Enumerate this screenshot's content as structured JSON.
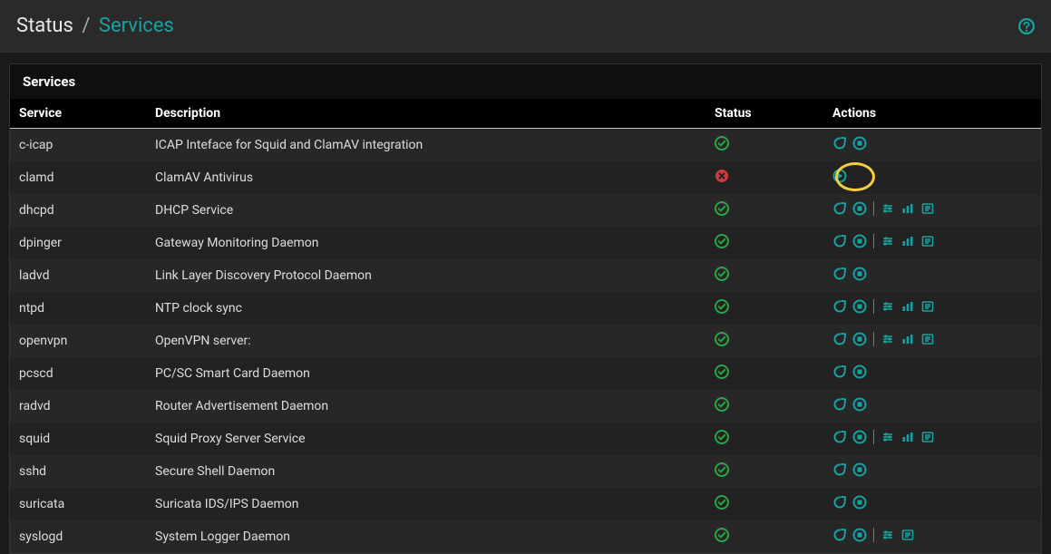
{
  "breadcrumb": {
    "root": "Status",
    "sep": "/",
    "leaf": "Services"
  },
  "panel_title": "Services",
  "columns": {
    "service": "Service",
    "description": "Description",
    "status": "Status",
    "actions": "Actions"
  },
  "icons": {
    "help": "help",
    "check": "check-circle",
    "times": "times-circle",
    "restart": "restart",
    "stop": "stop",
    "play": "play",
    "sliders": "sliders",
    "chart": "bar-chart",
    "log": "log"
  },
  "accent": "#17a2a0",
  "services": [
    {
      "name": "c-icap",
      "desc": "ICAP Inteface for Squid and ClamAV integration",
      "status": "ok",
      "actions": [
        "restart",
        "stop"
      ],
      "highlight": false
    },
    {
      "name": "clamd",
      "desc": "ClamAV Antivirus",
      "status": "bad",
      "actions": [
        "play"
      ],
      "highlight": true
    },
    {
      "name": "dhcpd",
      "desc": "DHCP Service",
      "status": "ok",
      "actions": [
        "restart",
        "stop",
        "|",
        "sliders",
        "chart",
        "log"
      ],
      "highlight": false
    },
    {
      "name": "dpinger",
      "desc": "Gateway Monitoring Daemon",
      "status": "ok",
      "actions": [
        "restart",
        "stop",
        "|",
        "sliders",
        "chart",
        "log"
      ],
      "highlight": false
    },
    {
      "name": "ladvd",
      "desc": "Link Layer Discovery Protocol Daemon",
      "status": "ok",
      "actions": [
        "restart",
        "stop"
      ],
      "highlight": false
    },
    {
      "name": "ntpd",
      "desc": "NTP clock sync",
      "status": "ok",
      "actions": [
        "restart",
        "stop",
        "|",
        "sliders",
        "chart",
        "log"
      ],
      "highlight": false
    },
    {
      "name": "openvpn",
      "desc": "OpenVPN server:",
      "status": "ok",
      "actions": [
        "restart",
        "stop",
        "|",
        "sliders",
        "chart",
        "log"
      ],
      "highlight": false
    },
    {
      "name": "pcscd",
      "desc": "PC/SC Smart Card Daemon",
      "status": "ok",
      "actions": [
        "restart",
        "stop"
      ],
      "highlight": false
    },
    {
      "name": "radvd",
      "desc": "Router Advertisement Daemon",
      "status": "ok",
      "actions": [
        "restart",
        "stop"
      ],
      "highlight": false
    },
    {
      "name": "squid",
      "desc": "Squid Proxy Server Service",
      "status": "ok",
      "actions": [
        "restart",
        "stop",
        "|",
        "sliders",
        "chart",
        "log"
      ],
      "highlight": false
    },
    {
      "name": "sshd",
      "desc": "Secure Shell Daemon",
      "status": "ok",
      "actions": [
        "restart",
        "stop"
      ],
      "highlight": false
    },
    {
      "name": "suricata",
      "desc": "Suricata IDS/IPS Daemon",
      "status": "ok",
      "actions": [
        "restart",
        "stop"
      ],
      "highlight": false
    },
    {
      "name": "syslogd",
      "desc": "System Logger Daemon",
      "status": "ok",
      "actions": [
        "restart",
        "stop",
        "|",
        "sliders",
        "log"
      ],
      "highlight": false
    }
  ]
}
